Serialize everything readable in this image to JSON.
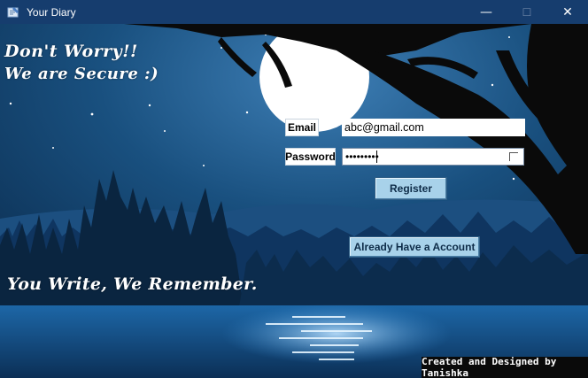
{
  "window": {
    "title": "Your Diary",
    "controls": {
      "minimize": "—",
      "maximize": "☐",
      "close": "✕"
    }
  },
  "background": {
    "sky_color": "#123c6a",
    "moon_color": "#ffffff",
    "forest_color": "#0c2540",
    "water_color": "#1b5c9a"
  },
  "taglines": {
    "line1": "Don't Worry!!",
    "line2": "We are Secure :)",
    "line3": "You Write, We Remember."
  },
  "form": {
    "email_label": "Email",
    "email_value": "abc@gmail.com",
    "password_label": "Password",
    "password_value": "•••••••••"
  },
  "buttons": {
    "register": "Register",
    "already_have_account": "Already Have a Account"
  },
  "footer": {
    "credit": "Created and Designed by Tanishka"
  }
}
